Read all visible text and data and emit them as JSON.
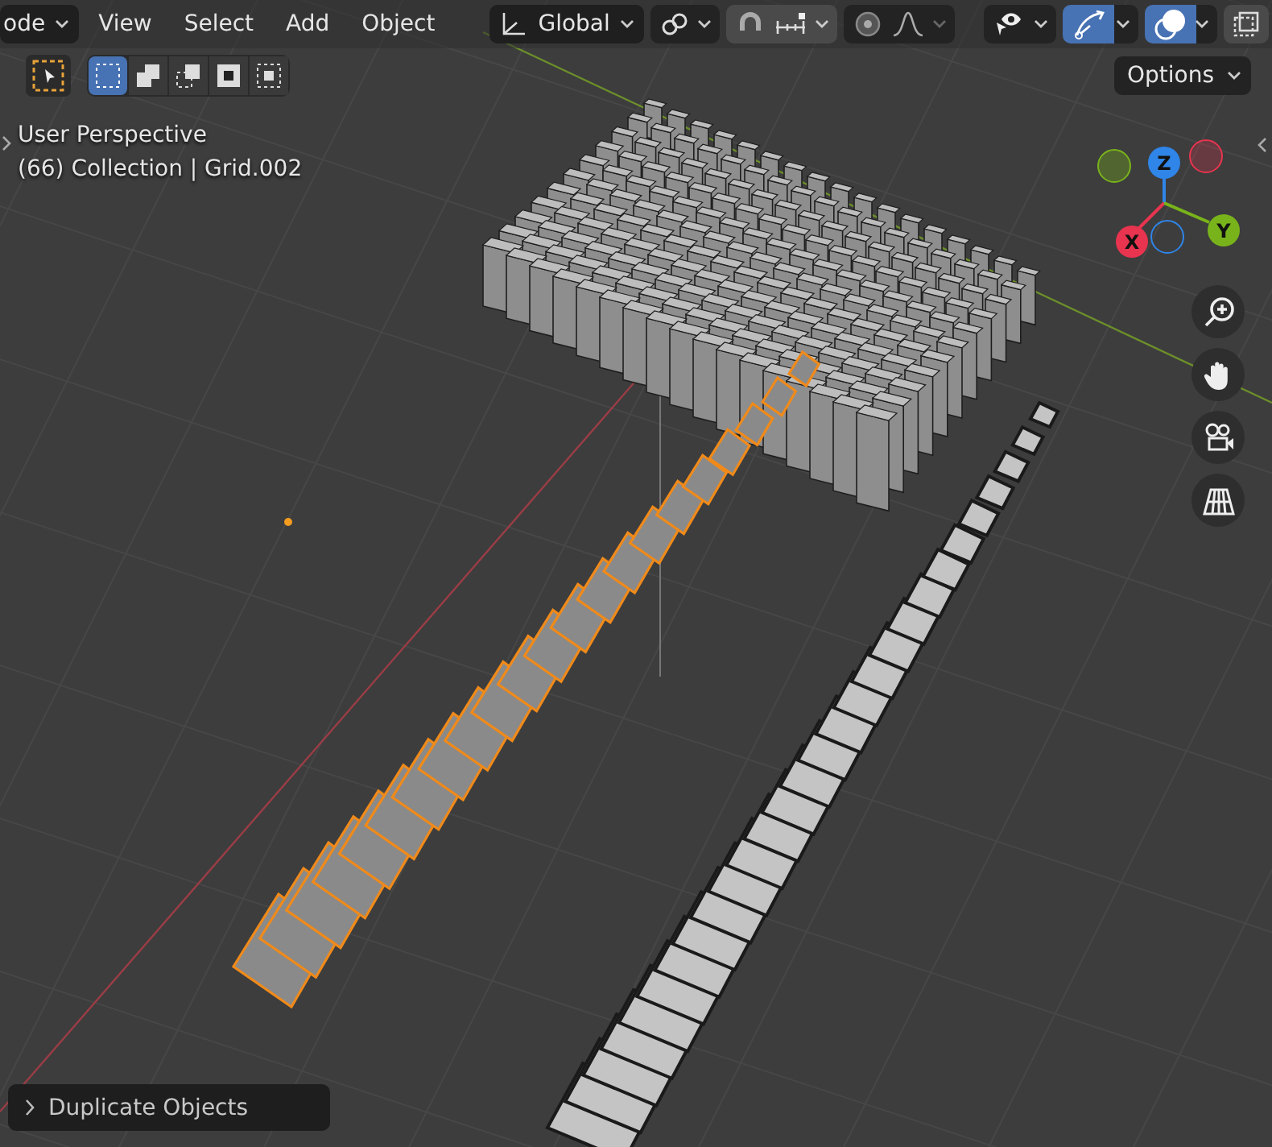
{
  "header": {
    "mode": {
      "label": "ode"
    },
    "menus": [
      {
        "label": "View"
      },
      {
        "label": "Select"
      },
      {
        "label": "Add"
      },
      {
        "label": "Object"
      }
    ],
    "transform_orientation": {
      "label": "Global"
    },
    "toggles": [
      {
        "kind": "pivot",
        "on": false
      },
      {
        "kind": "snap",
        "on": false
      },
      {
        "kind": "proportional",
        "on": false
      },
      {
        "kind": "visibility",
        "on": false
      },
      {
        "kind": "gizmo",
        "on": true
      },
      {
        "kind": "overlay",
        "on": true
      },
      {
        "kind": "xray",
        "on": false
      }
    ]
  },
  "toolbar": {
    "active_tool": {
      "selected": true
    },
    "select_modes": [
      {
        "kind": "new",
        "selected": true
      },
      {
        "kind": "extend",
        "selected": false
      },
      {
        "kind": "subtract",
        "selected": false
      },
      {
        "kind": "invert",
        "selected": false
      },
      {
        "kind": "intersect",
        "selected": false
      }
    ]
  },
  "viewport": {
    "info": [
      "User Perspective",
      "(66) Collection | Grid.002"
    ],
    "options": {
      "label": "Options"
    },
    "axes": [
      {
        "label": "Z",
        "color": "#2f85e8"
      },
      {
        "label": "X",
        "color": "#e8344f"
      },
      {
        "label": "Y",
        "color": "#79b31b"
      }
    ],
    "navigation": [
      {
        "kind": "zoom"
      },
      {
        "kind": "pan"
      },
      {
        "kind": "camera"
      },
      {
        "kind": "ortho"
      }
    ],
    "last_operation": {
      "label": "Duplicate Objects",
      "expanded": false
    }
  }
}
